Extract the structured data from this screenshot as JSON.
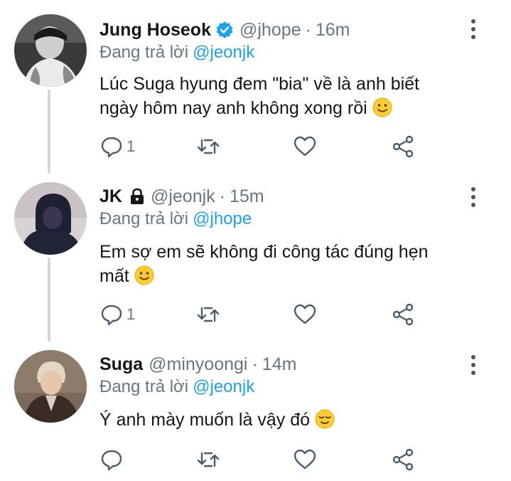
{
  "tweets": [
    {
      "name": "Jung Hoseok",
      "verified": true,
      "handle": "@jhope",
      "separator": "·",
      "time": "16m",
      "reply_prefix": "Đang trả lời",
      "reply_to": "@jeonjk",
      "line1": "Lúc Suga hyung đem \"bia\" về là anh biết",
      "line2": "ngày hôm nay anh không xong rồi",
      "emoji": "slightly-smiling-face",
      "reply_count": "1"
    },
    {
      "name": "JK",
      "protected": true,
      "handle": "@jeonjk",
      "separator": "·",
      "time": "15m",
      "reply_prefix": "Đang trả lời",
      "reply_to": "@jhope",
      "line1": "Em sợ em sẽ không đi công tác đúng hẹn",
      "line2": "mất",
      "emoji": "slightly-smiling-face",
      "reply_count": "1"
    },
    {
      "name": "Suga",
      "handle": "@minyoongi",
      "separator": "·",
      "time": "14m",
      "reply_prefix": "Đang trả lời",
      "reply_to": "@jeonjk",
      "line1": "Ý anh mày muốn là vậy đó",
      "emoji": "relieved-face",
      "reply_count": ""
    }
  ],
  "colors": {
    "accent": "#1da1f2",
    "muted": "#657786",
    "thread_line": "#cfd9de",
    "emoji": "#ffcc33"
  }
}
